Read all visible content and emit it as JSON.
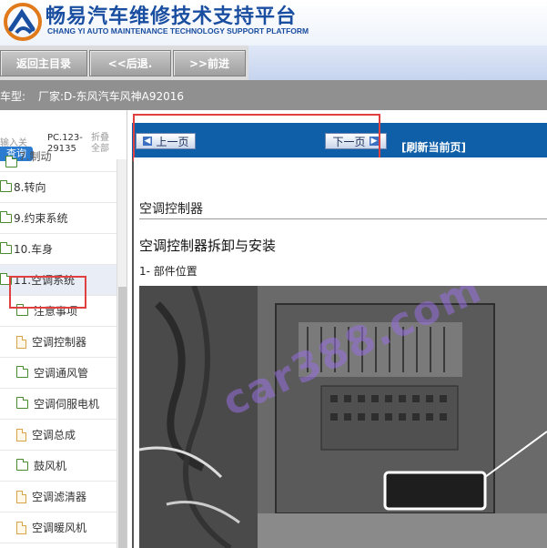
{
  "header": {
    "title": "畅易汽车维修技术支持平台",
    "subtitle": "CHANG YI AUTO MAINTENANCE TECHNOLOGY SUPPORT PLATFORM"
  },
  "nav": {
    "home_label": "返回主目录",
    "back_label": "<<后退.",
    "forward_label": ">>前进"
  },
  "model_bar": {
    "label": "车型:",
    "value": "厂家:D-东风汽车风神A92016"
  },
  "left_panel": {
    "tab_input": "输入关",
    "tab_query": "查询",
    "tab_pc": "PC.123-\n29135",
    "tab_fold": "折叠\n全部",
    "tree_items": [
      {
        "label": "7.制动",
        "icon": "folder-icon"
      },
      {
        "label": "8.转向",
        "icon": "folder-icon"
      },
      {
        "label": "9.约束系统",
        "icon": "folder-icon"
      },
      {
        "label": "10.车身",
        "icon": "folder-icon"
      },
      {
        "label": "11.空调系统",
        "icon": "folder-open-icon"
      },
      {
        "label": "注意事项",
        "icon": "folder-icon"
      },
      {
        "label": "空调控制器",
        "icon": "document-icon"
      },
      {
        "label": "空调通风管",
        "icon": "folder-icon"
      },
      {
        "label": "空调伺服电机",
        "icon": "folder-icon"
      },
      {
        "label": "空调总成",
        "icon": "document-icon"
      },
      {
        "label": "鼓风机",
        "icon": "folder-icon"
      },
      {
        "label": "空调滤清器",
        "icon": "document-icon"
      },
      {
        "label": "空调暖风机",
        "icon": "document-icon"
      }
    ]
  },
  "pager": {
    "prev_label": "上一页",
    "next_label": "下一页",
    "refresh_label": "[刷新当前页]"
  },
  "content": {
    "section_title": "空调控制器",
    "subsection_title": "空调控制器拆卸与安装",
    "part_location": "1- 部件位置",
    "watermark": "car388.com"
  },
  "colors": {
    "brand_blue": "#1a4ea0",
    "pager_bg": "#0f5fa8",
    "highlight_red": "#e04040"
  }
}
